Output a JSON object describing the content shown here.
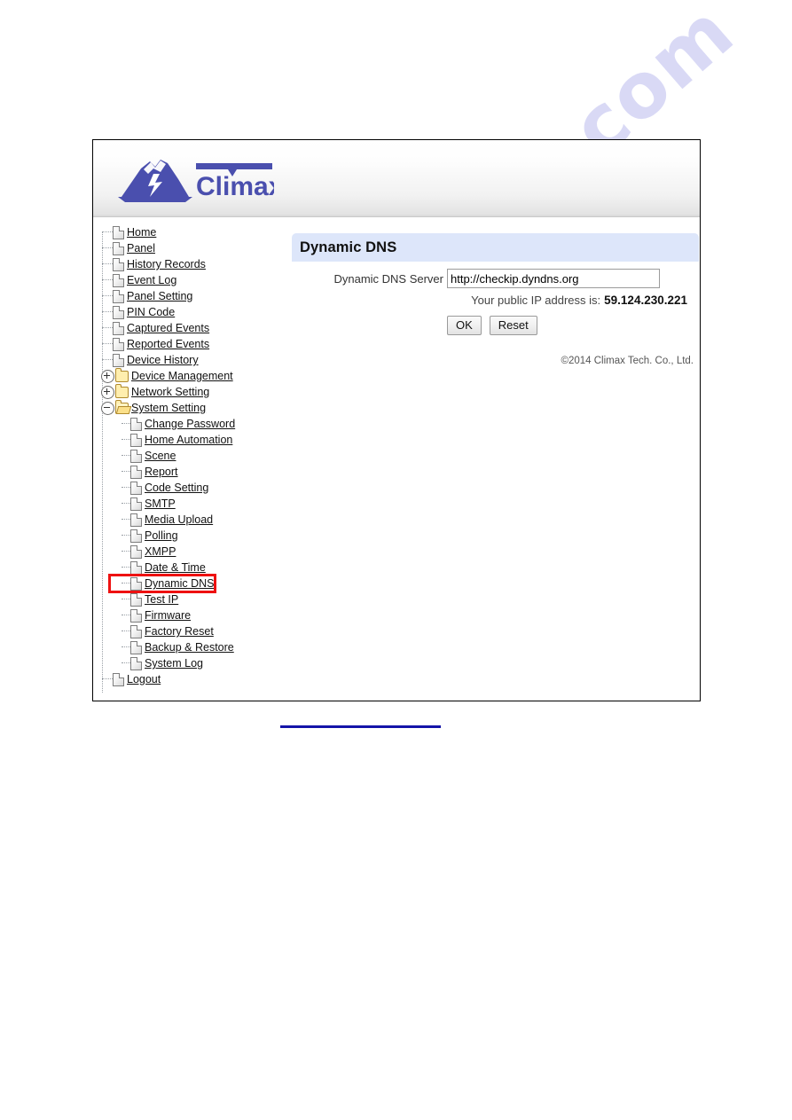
{
  "watermark": {
    "text": "manualshive.com"
  },
  "brand": {
    "name": "Climax",
    "logo_icon": "climax-mountain-lightning-logo"
  },
  "sidebar": {
    "items": [
      {
        "label": "Home",
        "icon": "file-icon",
        "level": 1,
        "toggle": "none"
      },
      {
        "label": "Panel",
        "icon": "file-icon",
        "level": 1,
        "toggle": "none"
      },
      {
        "label": "History Records",
        "icon": "file-icon",
        "level": 1,
        "toggle": "none"
      },
      {
        "label": "Event Log",
        "icon": "file-icon",
        "level": 1,
        "toggle": "none"
      },
      {
        "label": "Panel Setting",
        "icon": "file-icon",
        "level": 1,
        "toggle": "none"
      },
      {
        "label": "PIN Code",
        "icon": "file-icon",
        "level": 1,
        "toggle": "none"
      },
      {
        "label": "Captured Events",
        "icon": "file-icon",
        "level": 1,
        "toggle": "none"
      },
      {
        "label": "Reported Events",
        "icon": "file-icon",
        "level": 1,
        "toggle": "none"
      },
      {
        "label": "Device History",
        "icon": "file-icon",
        "level": 1,
        "toggle": "none"
      },
      {
        "label": "Device Management",
        "icon": "folder-icon",
        "level": 1,
        "toggle": "plus"
      },
      {
        "label": "Network Setting",
        "icon": "folder-icon",
        "level": 1,
        "toggle": "plus"
      },
      {
        "label": "System Setting",
        "icon": "folder-open-icon",
        "level": 1,
        "toggle": "minus"
      },
      {
        "label": "Change Password",
        "icon": "file-icon",
        "level": 2,
        "toggle": "none"
      },
      {
        "label": "Home Automation",
        "icon": "file-icon",
        "level": 2,
        "toggle": "none"
      },
      {
        "label": "Scene",
        "icon": "file-icon",
        "level": 2,
        "toggle": "none"
      },
      {
        "label": "Report",
        "icon": "file-icon",
        "level": 2,
        "toggle": "none"
      },
      {
        "label": "Code Setting",
        "icon": "file-icon",
        "level": 2,
        "toggle": "none"
      },
      {
        "label": "SMTP",
        "icon": "file-icon",
        "level": 2,
        "toggle": "none"
      },
      {
        "label": "Media Upload",
        "icon": "file-icon",
        "level": 2,
        "toggle": "none"
      },
      {
        "label": "Polling",
        "icon": "file-icon",
        "level": 2,
        "toggle": "none"
      },
      {
        "label": "XMPP",
        "icon": "file-icon",
        "level": 2,
        "toggle": "none"
      },
      {
        "label": "Date & Time",
        "icon": "file-icon",
        "level": 2,
        "toggle": "none"
      },
      {
        "label": "Dynamic DNS",
        "icon": "file-icon",
        "level": 2,
        "toggle": "none",
        "highlight": true
      },
      {
        "label": "Test IP",
        "icon": "file-icon",
        "level": 2,
        "toggle": "none"
      },
      {
        "label": "Firmware",
        "icon": "file-icon",
        "level": 2,
        "toggle": "none"
      },
      {
        "label": "Factory Reset",
        "icon": "file-icon",
        "level": 2,
        "toggle": "none"
      },
      {
        "label": "Backup & Restore",
        "icon": "file-icon",
        "level": 2,
        "toggle": "none"
      },
      {
        "label": "System Log",
        "icon": "file-icon",
        "level": 2,
        "toggle": "none"
      },
      {
        "label": "Logout",
        "icon": "file-icon",
        "level": 1,
        "toggle": "none"
      }
    ],
    "highlight_color": "#ee1111"
  },
  "content": {
    "title": "Dynamic DNS",
    "title_bg": "#dde6fa",
    "form": {
      "server_label": "Dynamic DNS Server",
      "server_value": "http://checkip.dyndns.org",
      "server_placeholder": "http://checkip.dyndns.org",
      "public_ip_label": "Your public IP address is:",
      "public_ip_value": "59.124.230.221",
      "ok_button": "OK",
      "reset_button": "Reset"
    },
    "copyright": "©2014 Climax Tech. Co., Ltd."
  },
  "footer_rule": {
    "color": "#1414a8"
  }
}
